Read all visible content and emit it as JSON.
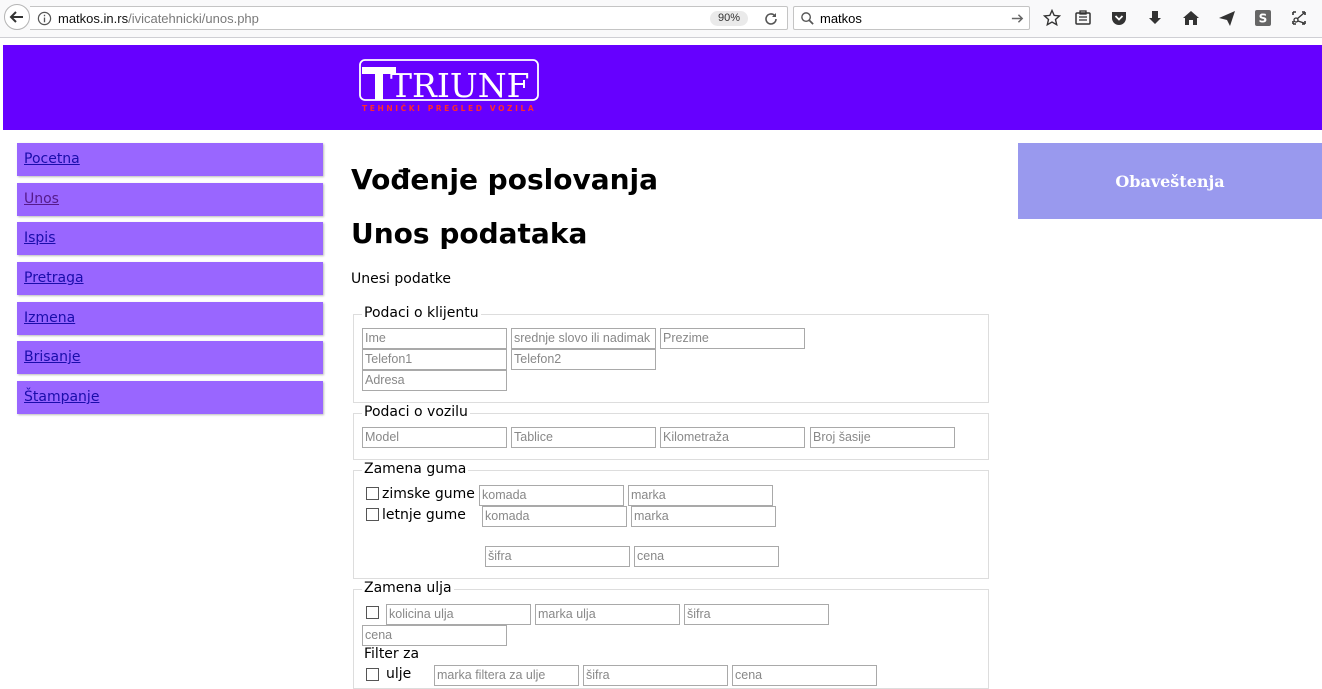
{
  "browser": {
    "url_host": "matkos.in.rs",
    "url_path": "/ivicatehnicki/unos.php",
    "zoom": "90%",
    "search_value": "matkos"
  },
  "brand": {
    "logo_text": "TRIUNF",
    "logo_tagline": "TEHNIČKI PREGLED VOZILA",
    "banner_color": "#6600ff",
    "nav_color": "#9966ff",
    "notice_color": "#9999ee"
  },
  "nav": {
    "items": [
      "Pocetna",
      "Unos",
      "Ispis",
      "Pretraga",
      "Izmena",
      "Brisanje",
      "Štampanje"
    ]
  },
  "notice": {
    "label": "Obaveštenja"
  },
  "main": {
    "title": "Vođenje poslovanja",
    "subtitle": "Unos podataka",
    "intro": "Unesi podatke"
  },
  "client": {
    "legend": "Podaci o klijentu",
    "ime": "Ime",
    "srednje": "srednje slovo ili nadimak",
    "prezime": "Prezime",
    "telefon1": "Telefon1",
    "telefon2": "Telefon2",
    "adresa": "Adresa"
  },
  "vehicle": {
    "legend": "Podaci o vozilu",
    "model": "Model",
    "tablice": "Tablice",
    "kilometraza": "Kilometraža",
    "sasija": "Broj šasije"
  },
  "tires": {
    "legend": "Zamena guma",
    "winter_label": "zimske gume",
    "summer_label": "letnje gume",
    "komada": "komada",
    "marka": "marka",
    "sifra": "šifra",
    "cena": "cena"
  },
  "oil": {
    "legend": "Zamena ulja",
    "kolicina": "kolicina ulja",
    "marka": "marka ulja",
    "sifra": "šifra",
    "cena": "cena",
    "filter_label": "Filter za",
    "filter_oil_label": "ulje",
    "filter_marka": "marka filtera za ulje",
    "filter_sifra": "šifra",
    "filter_cena": "cena"
  }
}
